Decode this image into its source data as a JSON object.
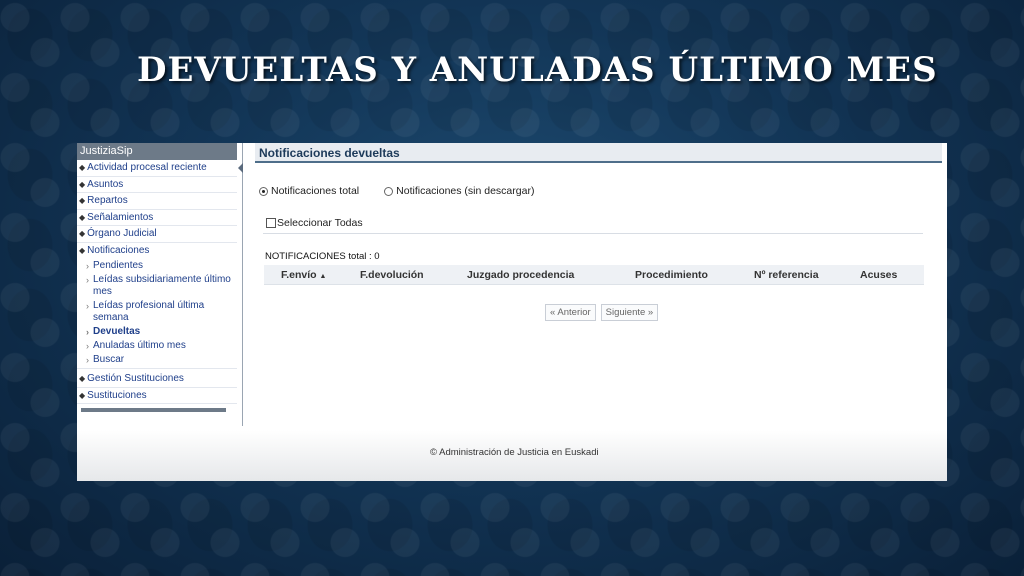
{
  "slide": {
    "title": "DEVUELTAS Y ANULADAS ÚLTIMO MES"
  },
  "sidebar": {
    "header": "JustiziaSip",
    "items": [
      {
        "label": "Actividad procesal reciente"
      },
      {
        "label": "Asuntos"
      },
      {
        "label": "Repartos"
      },
      {
        "label": "Señalamientos"
      },
      {
        "label": "Órgano Judicial"
      },
      {
        "label": "Notificaciones"
      },
      {
        "label": "Gestión Sustituciones"
      },
      {
        "label": "Sustituciones"
      }
    ],
    "notificaciones_sub": [
      {
        "label": "Pendientes"
      },
      {
        "label": "Leídas subsidiariamente último mes"
      },
      {
        "label": "Leídas profesional última semana"
      },
      {
        "label": "Devueltas",
        "active": true
      },
      {
        "label": "Anuladas último mes"
      },
      {
        "label": "Buscar"
      }
    ]
  },
  "panel": {
    "title": "Notificaciones devueltas",
    "radio_total": "Notificaciones total",
    "radio_sin_descargar": "Notificaciones (sin descargar)",
    "select_all": "Seleccionar Todas",
    "total_label": "NOTIFICACIONES total : 0",
    "columns": [
      "F.envío",
      "F.devolución",
      "Juzgado procedencia",
      "Procedimiento",
      "Nº referencia",
      "Acuses"
    ],
    "sort_indicator": "▲",
    "pager": {
      "prev": "« Anterior",
      "next": "Siguiente »"
    }
  },
  "footer": {
    "copyright": "© Administración de Justicia en Euskadi"
  }
}
